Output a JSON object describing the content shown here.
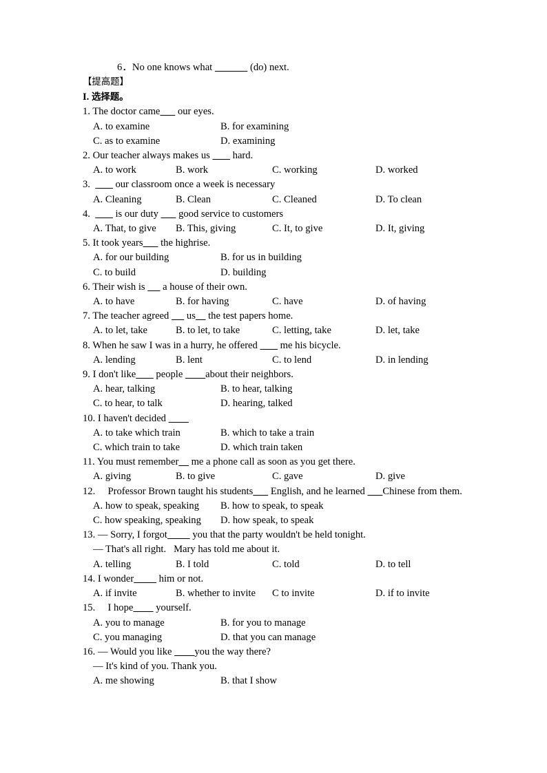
{
  "document": {
    "carryover_item": {
      "number": "6．",
      "text_before": "No one knows what ",
      "blank": "____________",
      "text_after": " (do) next."
    },
    "section_header": {
      "bracketed_label": "【提高题】",
      "roman_numeral": "I.",
      "title": "选择题。"
    },
    "questions": [
      {
        "number": "1.",
        "prompt": "The doctor came",
        "blank1": "______",
        "prompt_tail": " our eyes.",
        "options": [
          {
            "label": "A. to examine",
            "col": 0
          },
          {
            "label": "B. for examining",
            "col": 1
          },
          {
            "label": "C. as to examine",
            "col": 0
          },
          {
            "label": "D. examining",
            "col": 1
          }
        ],
        "layout": "2x2"
      },
      {
        "number": "2.",
        "prompt": "Our teacher always makes us ",
        "blank1": "_______",
        "prompt_tail": " hard.",
        "options": [
          {
            "label": "A. to work"
          },
          {
            "label": "B. work"
          },
          {
            "label": "C. working"
          },
          {
            "label": "D. worked"
          }
        ],
        "layout": "1x4"
      },
      {
        "number": "3.",
        "prompt": " ",
        "blank1": "_______",
        "prompt_tail": " our classroom once a week is necessary",
        "options": [
          {
            "label": "A. Cleaning"
          },
          {
            "label": "B. Clean"
          },
          {
            "label": "C. Cleaned"
          },
          {
            "label": "D. To clean"
          }
        ],
        "layout": "1x4"
      },
      {
        "number": "4.",
        "prompt": " ",
        "blank1": "_______",
        "mid": " is our duty ",
        "blank2": "______",
        "prompt_tail": " good service to customers",
        "options": [
          {
            "label": "A. That, to give"
          },
          {
            "label": "B. This, giving"
          },
          {
            "label": "C. It, to give"
          },
          {
            "label": "D. It, giving"
          }
        ],
        "layout": "1x4"
      },
      {
        "number": "5.",
        "prompt": "It took years",
        "blank1": "______",
        "prompt_tail": " the highrise.",
        "options": [
          {
            "label": "A. for our building"
          },
          {
            "label": "B. for us in building"
          },
          {
            "label": "C. to build"
          },
          {
            "label": "D. building"
          }
        ],
        "layout": "2x2"
      },
      {
        "number": "6.",
        "prompt": "Their wish is ",
        "blank1": "_____",
        "prompt_tail": " a house of their own.",
        "options": [
          {
            "label": "A. to have"
          },
          {
            "label": "B. for having"
          },
          {
            "label": "C. have"
          },
          {
            "label": "D. of having"
          }
        ],
        "layout": "1x4"
      },
      {
        "number": "7.",
        "prompt": "The teacher agreed ",
        "blank1": "_____",
        "mid": " us",
        "blank2": "____",
        "prompt_tail": " the test papers home.",
        "options": [
          {
            "label": "A. to let, take"
          },
          {
            "label": "B. to let, to take"
          },
          {
            "label": "C. letting, take"
          },
          {
            "label": "D. let, take"
          }
        ],
        "layout": "1x4"
      },
      {
        "number": "8.",
        "prompt": "When he saw I was in a hurry, he offered ",
        "blank1": "_______",
        "prompt_tail": " me his bicycle.",
        "options": [
          {
            "label": "A. lending"
          },
          {
            "label": "B. lent"
          },
          {
            "label": "C. to lend"
          },
          {
            "label": "D. in lending"
          }
        ],
        "layout": "1x4"
      },
      {
        "number": "9.",
        "prompt": "I don't like",
        "blank1": "_______",
        "mid": " people ",
        "blank2": "________",
        "prompt_tail": "about their neighbors.",
        "options": [
          {
            "label": "A. hear, talking"
          },
          {
            "label": "B. to hear, talking"
          },
          {
            "label": "C. to hear, to talk"
          },
          {
            "label": "D. hearing, talked"
          }
        ],
        "layout": "2x2"
      },
      {
        "number": "10.",
        "prompt": "I haven't decided ",
        "blank1": "________",
        "prompt_tail": "",
        "options": [
          {
            "label": "A. to take which train"
          },
          {
            "label": "B. which to take a train"
          },
          {
            "label": "C. which train to take"
          },
          {
            "label": "D. which train taken"
          }
        ],
        "layout": "2x2"
      },
      {
        "number": "11.",
        "prompt": "You must remember",
        "blank1": "____",
        "prompt_tail": " me a phone call as soon as you get there.",
        "options": [
          {
            "label": "A. giving"
          },
          {
            "label": "B. to give"
          },
          {
            "label": "C. gave"
          },
          {
            "label": "D. give"
          }
        ],
        "layout": "1x4"
      },
      {
        "number": "12.",
        "prompt": "    Professor Brown taught his students",
        "blank1": "______",
        "mid": " English, and he learned ",
        "blank2": "______",
        "prompt_tail": "Chinese from them.",
        "options": [
          {
            "label": "A. how to speak, speaking"
          },
          {
            "label": "B. how to speak, to speak"
          },
          {
            "label": "C. how speaking, speaking"
          },
          {
            "label": "D. how speak, to speak"
          }
        ],
        "layout": "2x2"
      },
      {
        "number": "13.",
        "prompt": "— Sorry, I forgot",
        "blank1": "_________",
        "prompt_tail": " you that the party wouldn't be held tonight.",
        "dialogue_reply": "— That's all right.   Mary has told me about it.",
        "options": [
          {
            "label": "A. telling"
          },
          {
            "label": "B. I told"
          },
          {
            "label": "C. told"
          },
          {
            "label": "D. to tell"
          }
        ],
        "layout": "1x4"
      },
      {
        "number": "14.",
        "prompt": "I wonder",
        "blank1": "_________",
        "prompt_tail": " him or not.",
        "options": [
          {
            "label": "A. if invite"
          },
          {
            "label": "B. whether to invite"
          },
          {
            "label": "C to invite"
          },
          {
            "label": "D. if to invite"
          }
        ],
        "layout": "1x4"
      },
      {
        "number": "15.",
        "prompt": "    I hope",
        "blank1": "________",
        "prompt_tail": " yourself.",
        "options": [
          {
            "label": "A. you to manage"
          },
          {
            "label": "B. for you to manage"
          },
          {
            "label": "C. you managing"
          },
          {
            "label": "D. that you can manage"
          }
        ],
        "layout": "2x2"
      },
      {
        "number": "16.",
        "prompt": "— Would you like ",
        "blank1": "________",
        "prompt_tail": "you the way there?",
        "dialogue_reply": "— It's kind of you. Thank you.",
        "options": [
          {
            "label": "A. me showing"
          },
          {
            "label": "B. that I show"
          }
        ],
        "layout": "2col-partial"
      }
    ]
  }
}
